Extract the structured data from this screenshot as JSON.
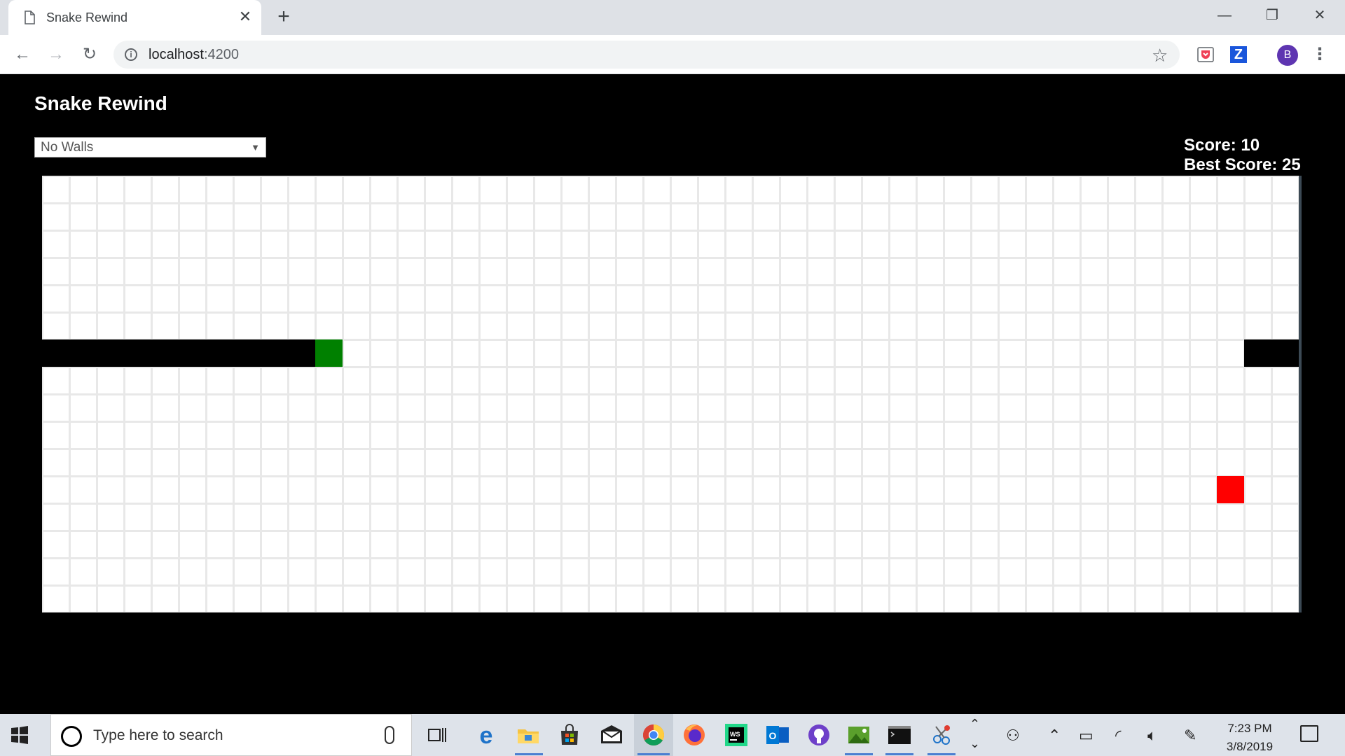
{
  "browser": {
    "tab_title": "Snake Rewind",
    "url_host": "localhost",
    "url_port": ":4200",
    "avatar_letter": "B",
    "ext_z_label": "Z"
  },
  "app": {
    "title": "Snake Rewind",
    "mode_selected": "No Walls",
    "score_label": "Score: 10",
    "best_score_label": "Best Score: 25",
    "score": 10,
    "best_score": 25
  },
  "game": {
    "cols": 46,
    "rows": 16,
    "snake_body": [
      [
        0,
        6
      ],
      [
        1,
        6
      ],
      [
        2,
        6
      ],
      [
        3,
        6
      ],
      [
        4,
        6
      ],
      [
        5,
        6
      ],
      [
        6,
        6
      ],
      [
        7,
        6
      ],
      [
        8,
        6
      ],
      [
        9,
        6
      ],
      [
        44,
        6
      ],
      [
        45,
        6
      ]
    ],
    "snake_head": [
      10,
      6
    ],
    "food": [
      43,
      11
    ],
    "colors": {
      "snake": "#000000",
      "head": "#008000",
      "food": "#ff0000",
      "grid_line": "#e8e8e8",
      "cell": "#ffffff"
    }
  },
  "taskbar": {
    "search_placeholder": "Type here to search",
    "time": "7:23 PM",
    "date": "3/8/2019"
  }
}
